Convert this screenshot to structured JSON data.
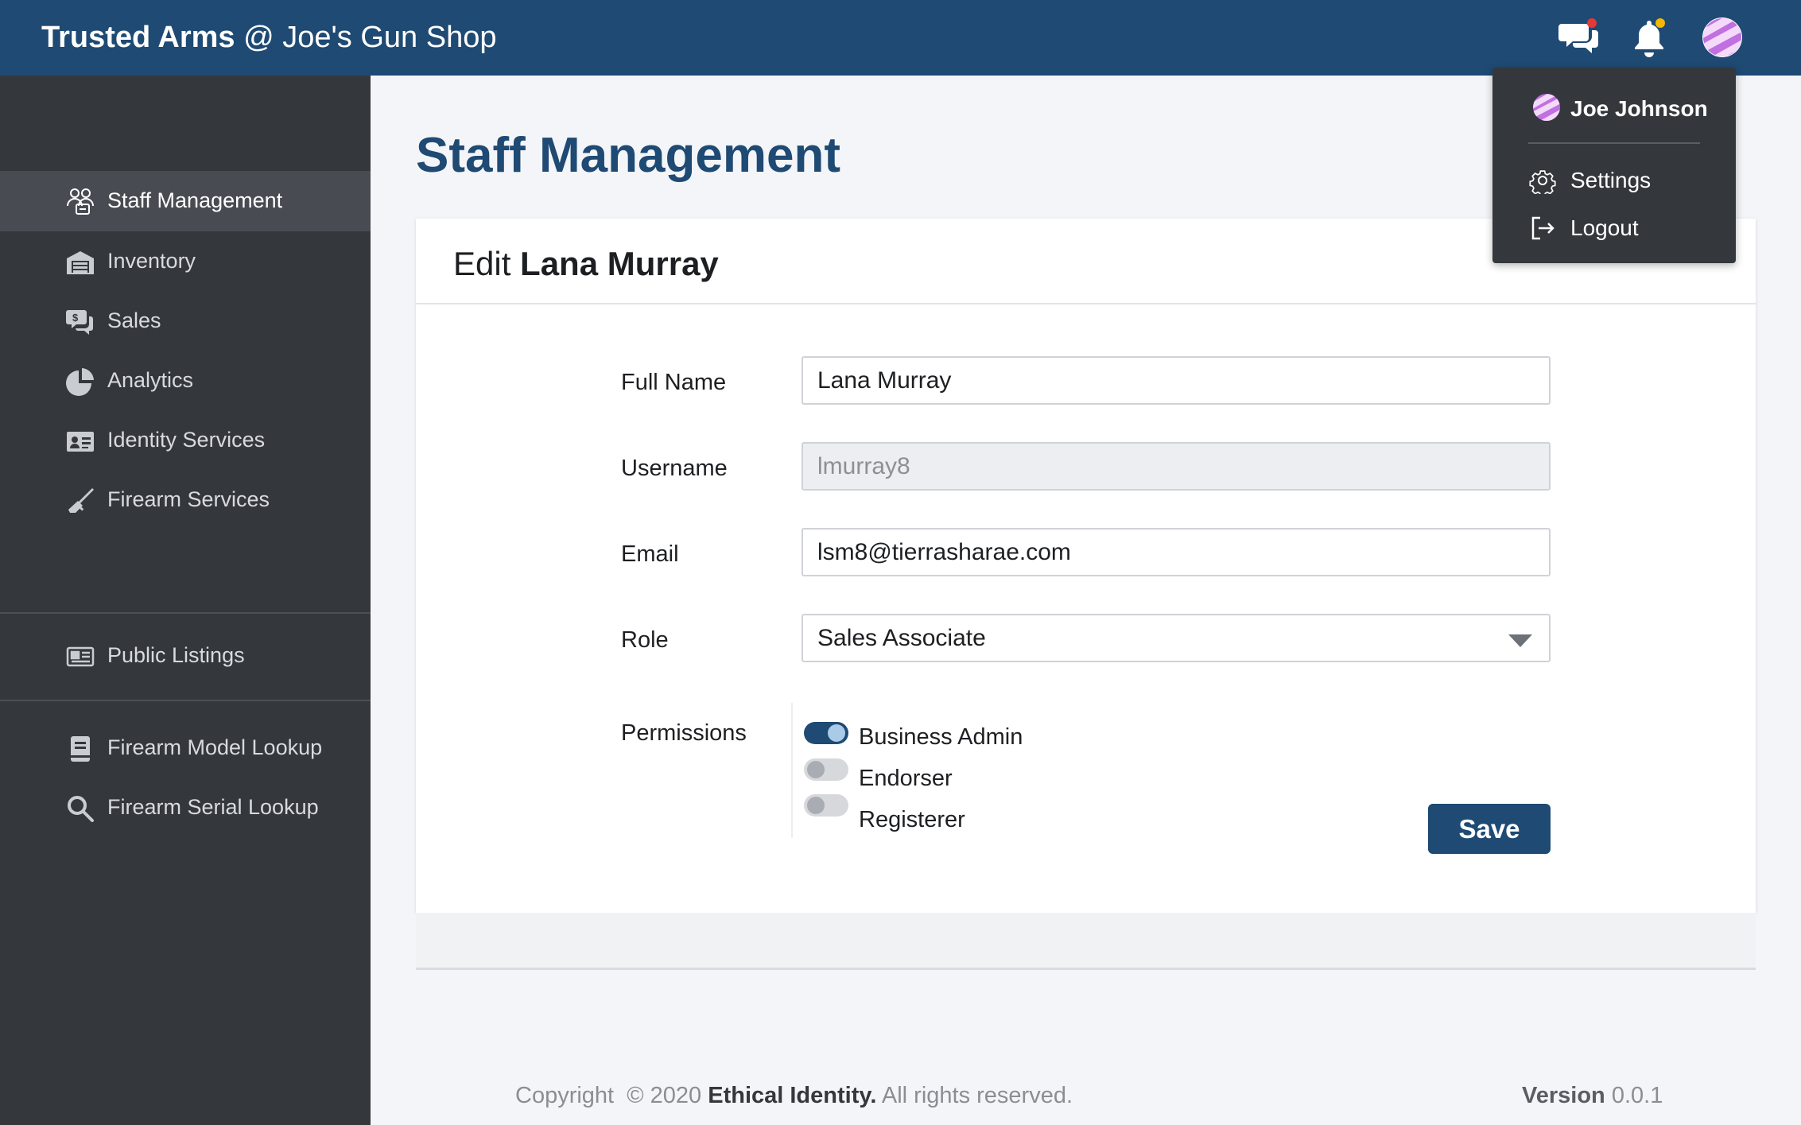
{
  "header": {
    "brand_bold": "Trusted Arms",
    "brand_rest": "@ Joe's Gun Shop",
    "icons": [
      "chat-icon",
      "bell-icon",
      "avatar"
    ]
  },
  "sidebar": {
    "items": [
      {
        "label": "Staff Management",
        "icon": "staff-icon",
        "active": true
      },
      {
        "label": "Inventory",
        "icon": "warehouse-icon"
      },
      {
        "label": "Sales",
        "icon": "sales-icon"
      },
      {
        "label": "Analytics",
        "icon": "pie-chart-icon"
      },
      {
        "label": "Identity Services",
        "icon": "id-card-icon"
      },
      {
        "label": "Firearm Services",
        "icon": "firearm-icon"
      },
      {
        "label": "Public Listings",
        "icon": "listing-icon"
      },
      {
        "label": "Firearm Model Lookup",
        "icon": "book-icon"
      },
      {
        "label": "Firearm Serial Lookup",
        "icon": "search-icon"
      }
    ]
  },
  "main": {
    "title": "Staff Management",
    "card": {
      "title_prefix": "Edit",
      "title_name": "Lana Murray",
      "fields": {
        "full_name": {
          "label": "Full Name",
          "value": "Lana Murray"
        },
        "username": {
          "label": "Username",
          "value": "lmurray8"
        },
        "email": {
          "label": "Email",
          "value": "lsm8@tierrasharae.com"
        },
        "role": {
          "label": "Role",
          "value": "Sales Associate"
        }
      },
      "permissions": {
        "label": "Permissions",
        "items": [
          {
            "label": "Business Admin",
            "enabled": true
          },
          {
            "label": "Endorser",
            "enabled": false
          },
          {
            "label": "Registerer",
            "enabled": false
          }
        ]
      },
      "save_label": "Save"
    }
  },
  "footer": {
    "copyright_prefix": "Copyright  © 2020",
    "company": "Ethical Identity.",
    "rights": "All rights reserved.",
    "version_label": "Version",
    "version_number": "0.0.1"
  },
  "user_menu": {
    "user_name": "Joe Johnson",
    "settings_label": "Settings",
    "logout_label": "Logout"
  },
  "colors": {
    "header": "#1e4a73",
    "sidebar": "#34383d",
    "accent": "#1e4a73",
    "chat_badge": "#e53935",
    "bell_badge": "#f5b800",
    "avatar": "#c070e0"
  }
}
